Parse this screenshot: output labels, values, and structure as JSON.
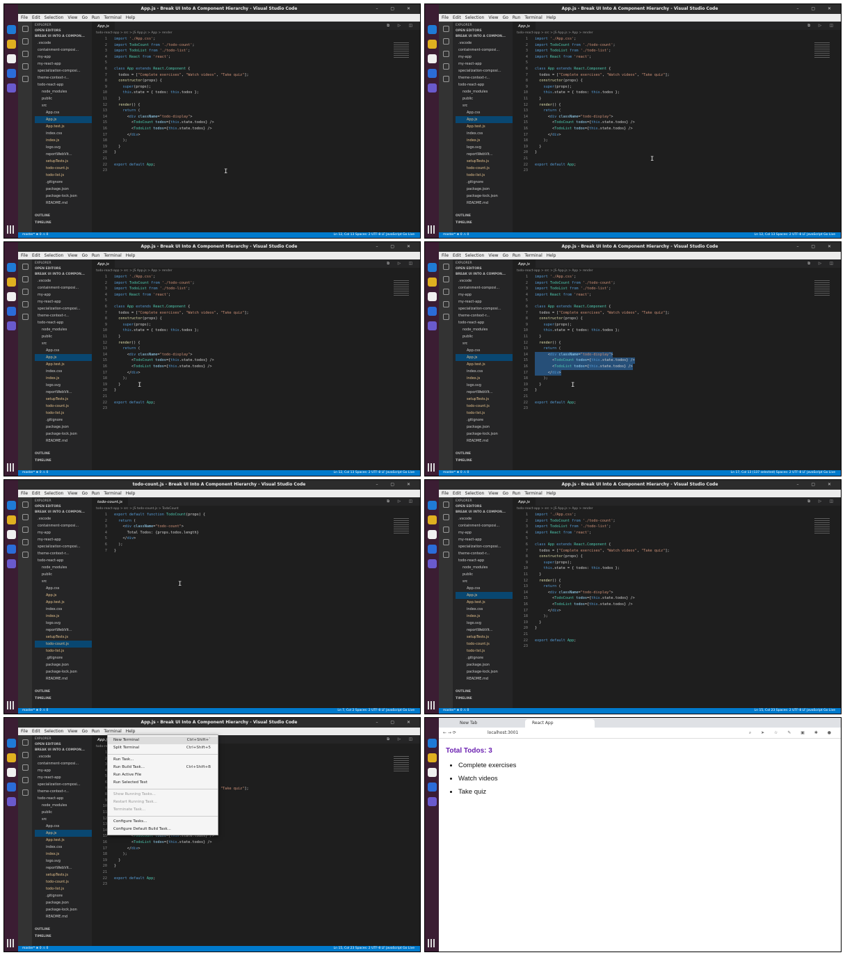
{
  "vscode": {
    "title_app": "App.js - Break UI Into A Component Hierarchy - Visual Studio Code",
    "title_count": "todo-count.js - Break UI Into A Component Hierarchy - Visual Studio Code",
    "menu": [
      "File",
      "Edit",
      "Selection",
      "View",
      "Go",
      "Run",
      "Terminal",
      "Help"
    ],
    "explorer_label": "EXPLORER",
    "open_editors": "OPEN EDITORS",
    "project": "BREAK UI INTO A COMPON...",
    "tree": [
      ".vscode",
      "containment-composi...",
      "my-app",
      "my-react-app",
      "specialization-composi...",
      "theme-context-r...",
      "todo-react-app",
      "node_modules",
      "public",
      "src",
      "App.css",
      "App.js",
      "App.test.js",
      "index.css",
      "index.js",
      "logo.svg",
      "reportWebVit...",
      "setupTests.js",
      "todo-count.js",
      "todo-list.js",
      ".gitignore",
      "package.json",
      "package-lock.json",
      "README.md"
    ],
    "outline": "OUTLINE",
    "timeline": "TIMELINE",
    "tab_app": "App.js",
    "tab_count": "todo-count.js",
    "crumb_app": "todo-react-app > src > JS App.js > App > render",
    "crumb_count": "todo-react-app > src > JS todo-count.js > TodoCount",
    "app_code": [
      "import './App.css';",
      "import TodoCount from './todo-count';",
      "import TodoList from './todo-list';",
      "import React from 'react';",
      "",
      "class App extends React.Component {",
      "  todos = [\"Complete exercises\", \"Watch videos\", \"Take quiz\"];",
      "  constructor(props) {",
      "    super(props);",
      "    this.state = { todos: this.todos };",
      "  }",
      "  render() {",
      "    return (",
      "      <div className=\"todo-display\">",
      "        <TodoCount todos={this.state.todos} />",
      "        <TodoList todos={this.state.todos} />",
      "      </div>",
      "    );",
      "  }",
      "}",
      "",
      "export default App;",
      ""
    ],
    "count_code": [
      "export default function TodoCount(props) {",
      "  return (",
      "    <div className=\"todo-count\">",
      "      Total Todos: {props.todos.length}",
      "    </div>",
      "  );",
      "}"
    ],
    "status_left": "master*  ⊗ 0 ⚠ 0",
    "status_right_1": "Ln 12, Col 13   Spaces: 2   UTF-8   LF   JavaScript   Go Live",
    "status_right_2": "Ln 17, Col 13 (137 selected)   Spaces: 2   UTF-8   LF   JavaScript   Go Live",
    "status_right_3": "Ln 7, Col 2   Spaces: 2   UTF-8   LF   JavaScript   Go Live",
    "status_right_4": "Ln 15, Col 23   Spaces: 2   UTF-8   LF   JavaScript   Go Live",
    "terminal_menu": [
      {
        "label": "New Terminal",
        "shortcut": "Ctrl+Shift+`"
      },
      {
        "label": "Split Terminal",
        "shortcut": "Ctrl+Shift+5"
      },
      {
        "sep": true
      },
      {
        "label": "Run Task...",
        "shortcut": ""
      },
      {
        "label": "Run Build Task...",
        "shortcut": "Ctrl+Shift+B"
      },
      {
        "label": "Run Active File",
        "shortcut": ""
      },
      {
        "label": "Run Selected Text",
        "shortcut": ""
      },
      {
        "sep": true
      },
      {
        "label": "Show Running Tasks...",
        "shortcut": "",
        "disabled": true
      },
      {
        "label": "Restart Running Task...",
        "shortcut": "",
        "disabled": true
      },
      {
        "label": "Terminate Task...",
        "shortcut": "",
        "disabled": true
      },
      {
        "sep": true
      },
      {
        "label": "Configure Tasks...",
        "shortcut": ""
      },
      {
        "label": "Configure Default Build Task...",
        "shortcut": ""
      }
    ]
  },
  "browser": {
    "tab_new": "New Tab",
    "tab_active": "React App",
    "url": "localhost:3001",
    "heading": "Total Todos: 3",
    "items": [
      "Complete exercises",
      "Watch videos",
      "Take quiz"
    ]
  }
}
